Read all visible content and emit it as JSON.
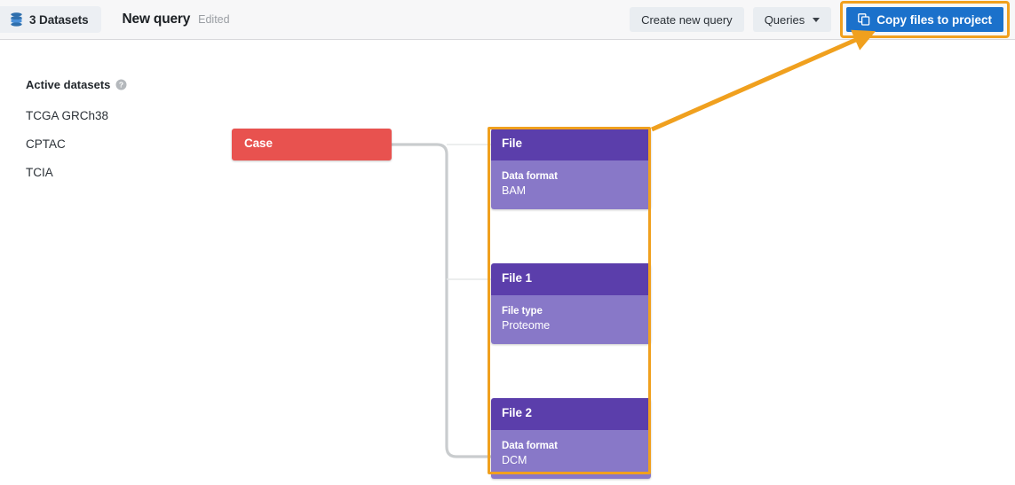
{
  "topbar": {
    "datasets_chip": {
      "icon": "database-stack-icon",
      "label": "3 Datasets"
    },
    "query_title": "New query",
    "query_state": "Edited",
    "create_new_query_label": "Create new query",
    "queries_label": "Queries",
    "copy_files_label": "Copy files to project",
    "copy_icon": "copy-files-icon",
    "primary_button_color": "#1b71cb",
    "highlight_color": "#f0a01e"
  },
  "left_panel": {
    "heading": "Active datasets",
    "help_icon": "help-circle-icon",
    "datasets": [
      {
        "label": "TCGA GRCh38"
      },
      {
        "label": "CPTAC"
      },
      {
        "label": "TCIA"
      }
    ]
  },
  "graph": {
    "case_node": {
      "title": "Case",
      "color": "#e8524f"
    },
    "file_nodes": [
      {
        "title": "File",
        "header_color": "#5b3eab",
        "body_color": "#8878c8",
        "property_key": "Data format",
        "property_value": "BAM"
      },
      {
        "title": "File 1",
        "header_color": "#5b3eab",
        "body_color": "#8878c8",
        "property_key": "File type",
        "property_value": "Proteome"
      },
      {
        "title": "File 2",
        "header_color": "#5b3eab",
        "body_color": "#8878c8",
        "property_key": "Data format",
        "property_value": "DCM"
      }
    ],
    "edge_color": "#c9ccce",
    "selection_color": "#f0a01e"
  },
  "annotation": {
    "arrow_color": "#f0a01e",
    "description": "arrow pointing from file node group to copy files to project button"
  }
}
